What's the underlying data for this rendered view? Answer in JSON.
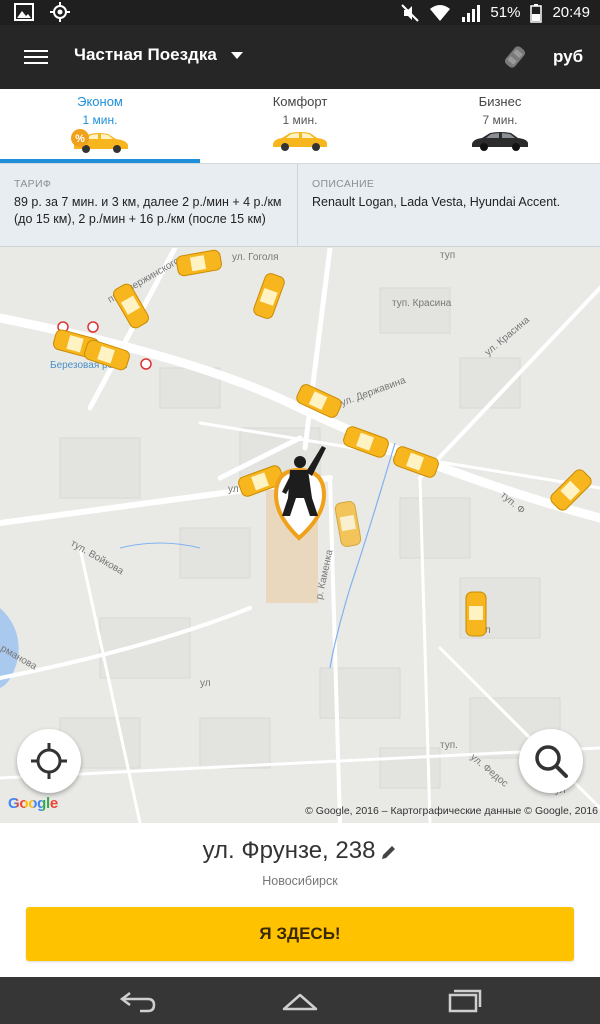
{
  "status_bar": {
    "battery": "51%",
    "time": "20:49",
    "icons": [
      "image-icon",
      "location-target-icon",
      "mute-icon",
      "wifi-icon",
      "signal-icon",
      "battery-icon"
    ]
  },
  "app_bar": {
    "title": "Частная Поездка",
    "currency": "руб",
    "icons": [
      "menu-icon",
      "dropdown-caret-icon",
      "compass-icon"
    ]
  },
  "tabs": [
    {
      "name": "Эконом",
      "eta": "1 мин.",
      "active": true
    },
    {
      "name": "Комфорт",
      "eta": "1 мин.",
      "active": false
    },
    {
      "name": "Бизнес",
      "eta": "7 мин.",
      "active": false
    }
  ],
  "tariff": {
    "label": "ТАРИФ",
    "text": "89 р. за 7 мин. и 3 км, далее 2 р./мин + 4 р./км (до 15 км), 2 р./мин + 16 р./км (после 15 км)"
  },
  "description": {
    "label": "ОПИСАНИЕ",
    "text": "Renault Logan, Lada Vesta, Hyundai Accent."
  },
  "map": {
    "streets": [
      "ул. Гоголя",
      "пр. Дзержинского",
      "туп. Красина",
      "ул. Красина",
      "ул. Державина",
      "ул",
      "Березовая роща",
      "туп. Войкова",
      "р. Каменка",
      "ул. Федос",
      "туп. Ф",
      "ул",
      "туп.",
      "ул",
      "ул",
      "туп",
      "рманова"
    ],
    "google": "Google",
    "copyright": "© Google, 2016 – Картографические данные © Google, 2016",
    "accent": "#ffc200",
    "pin_color": "#f0a11b"
  },
  "address": {
    "street": "ул. Фрунзе, 238",
    "city": "Новосибирск"
  },
  "cta": "Я ЗДЕСЬ!",
  "colors": {
    "active_tab": "#1e8fd8",
    "button": "#ffc200",
    "app_bar": "#262626"
  }
}
